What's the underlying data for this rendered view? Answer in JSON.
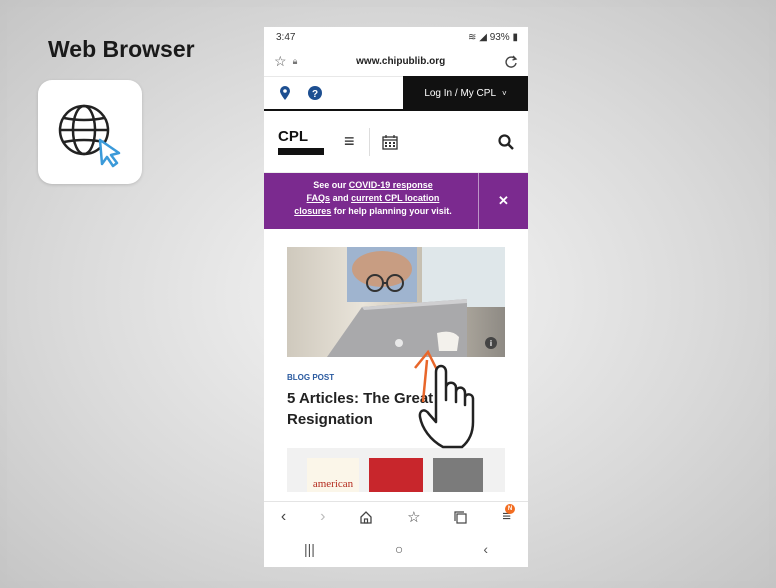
{
  "slide": {
    "title": "Web Browser"
  },
  "status_bar": {
    "time": "3:47",
    "battery": "93%"
  },
  "browser": {
    "url": "www.chipublib.org"
  },
  "site_nav": {
    "login_label": "Log In / My CPL"
  },
  "site_header": {
    "logo_text": "CPL"
  },
  "covid_banner": {
    "line1_prefix": "See our ",
    "link1": "COVID-19 response",
    "link2": "FAQs",
    "middle": " and ",
    "link3": "current CPL location",
    "link4": "closures",
    "suffix": " for help planning your visit.",
    "close_label": "✕"
  },
  "post": {
    "kind": "BLOG POST",
    "title": "5 Articles: The Great Resignation"
  },
  "books_strip": {
    "book1_text": "american"
  },
  "colors": {
    "banner": "#7b2a8f",
    "post_kind": "#2a5aa0",
    "pointer_arrow": "#e8662a"
  }
}
